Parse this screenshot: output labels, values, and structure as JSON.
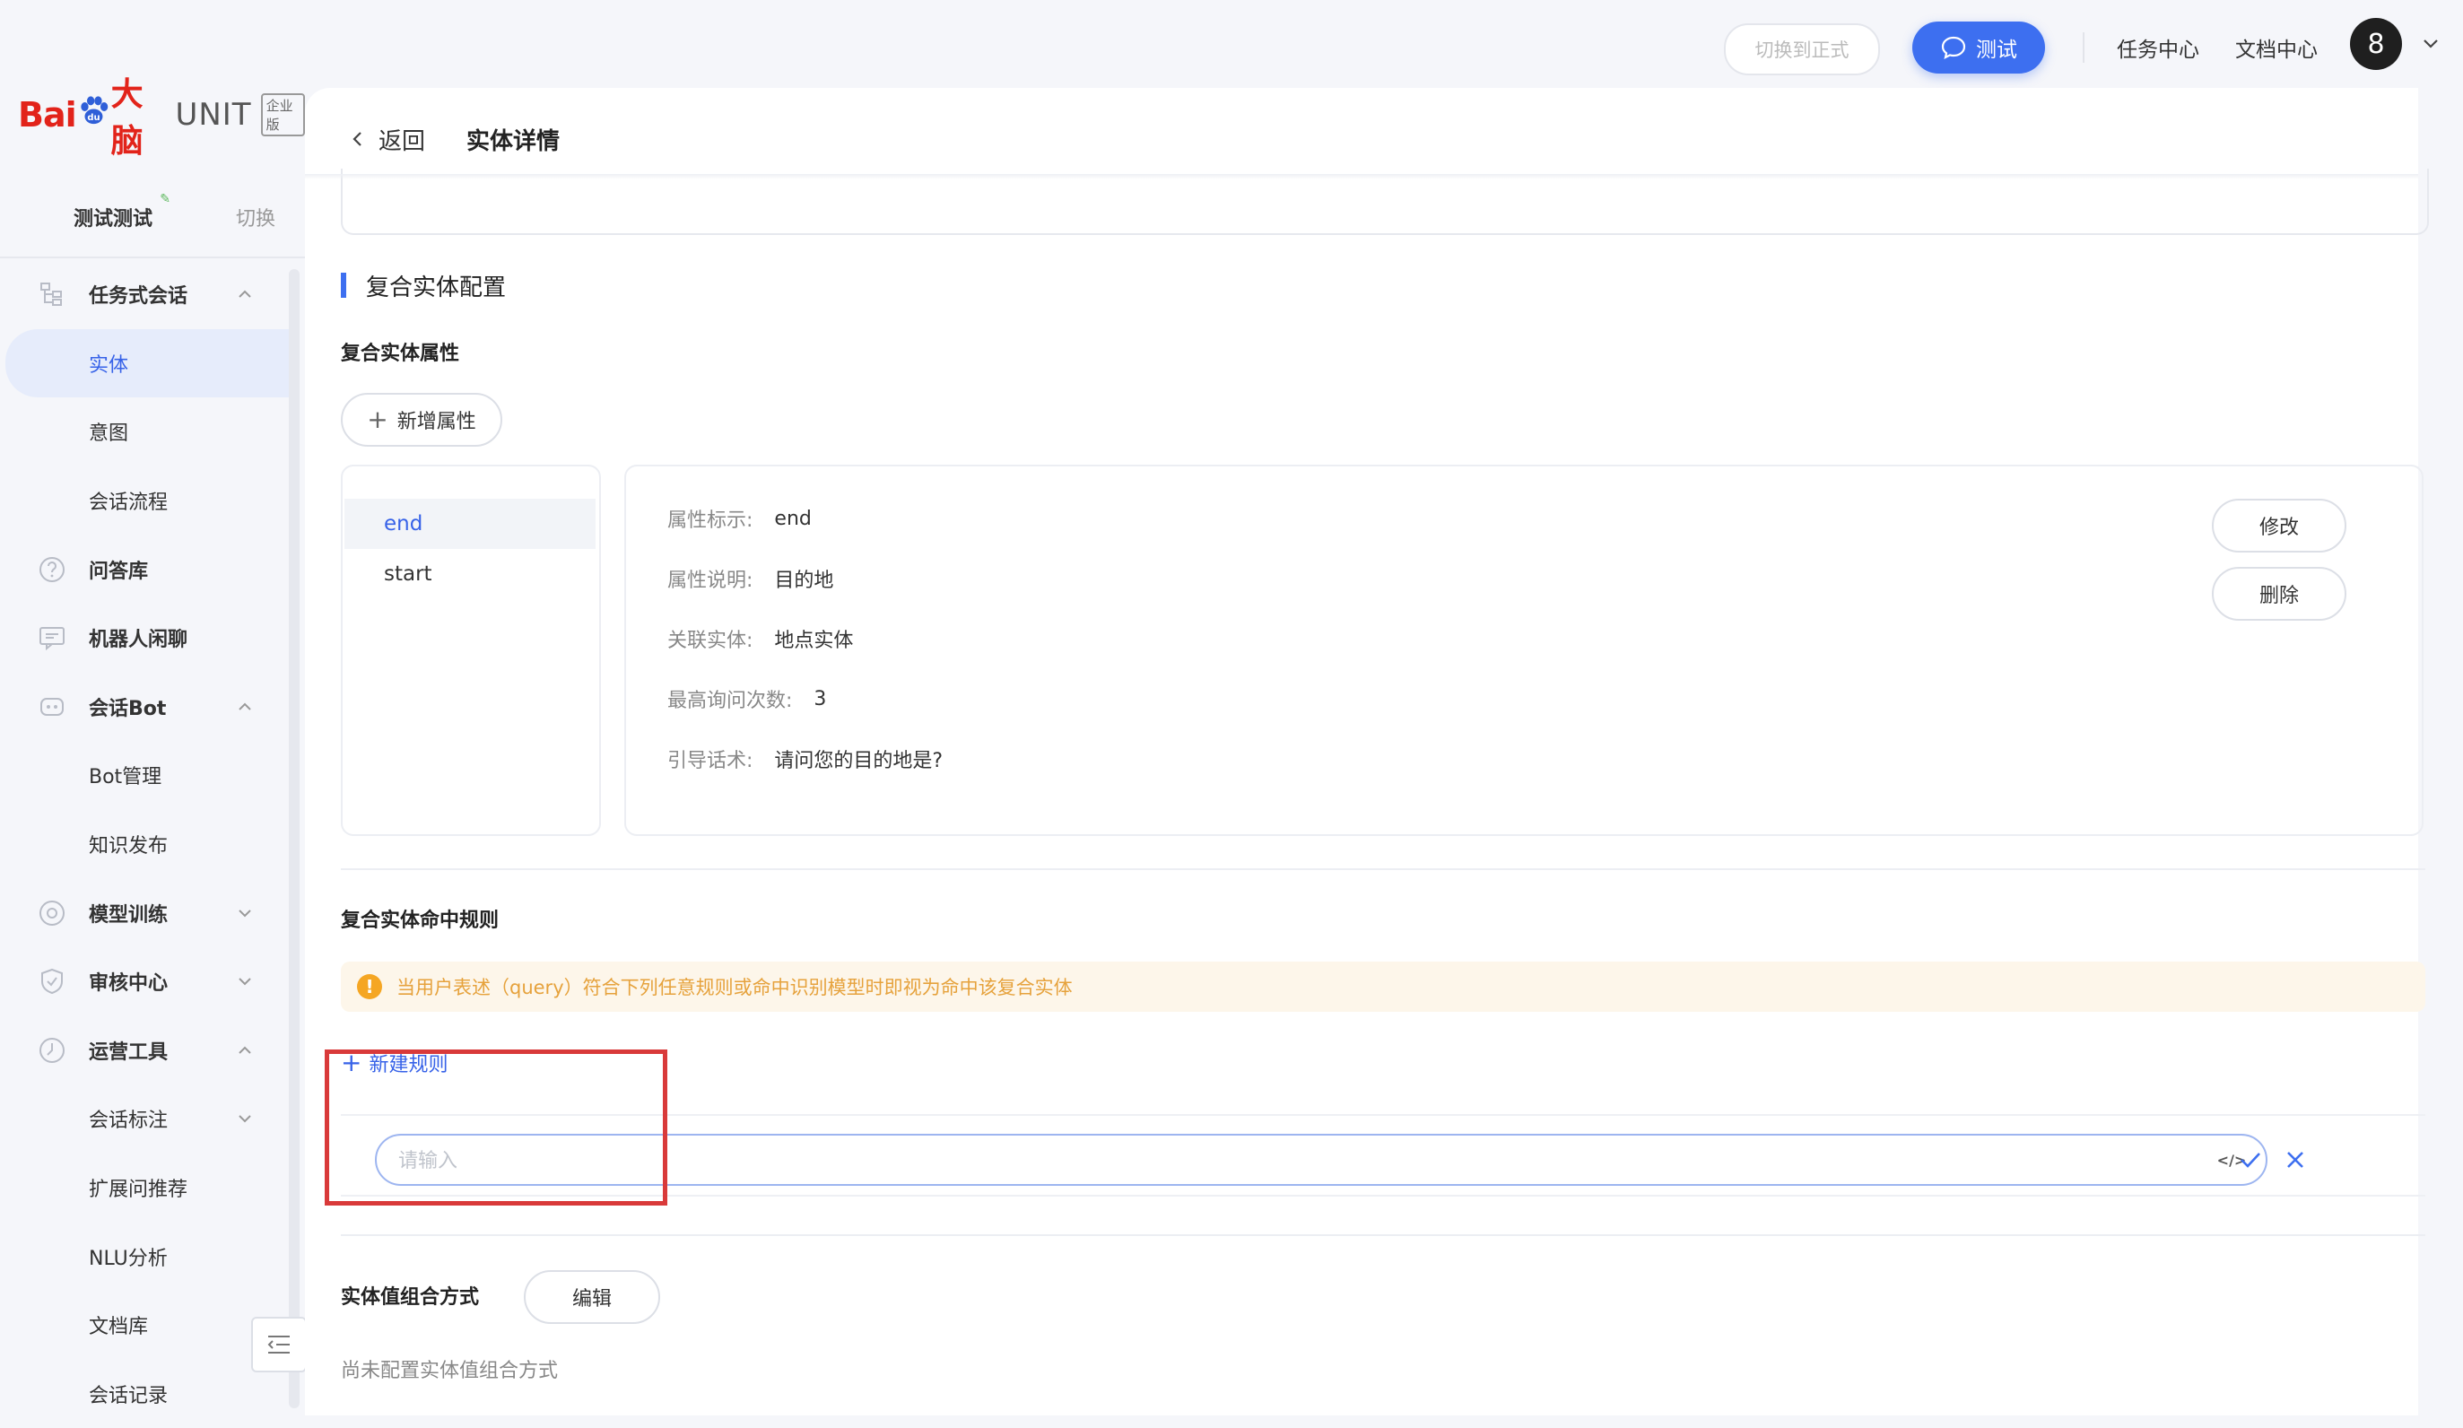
{
  "brand": {
    "logo_bai": "Bai",
    "logo_dan": "大脑",
    "product": "UNIT",
    "edition": "企业版"
  },
  "workspace": {
    "name": "测试测试",
    "switch_label": "切换"
  },
  "sidebar": {
    "items": [
      {
        "label": "任务式会话",
        "icon": "flow-icon",
        "group": true,
        "expanded": true
      },
      {
        "label": "实体",
        "active": true
      },
      {
        "label": "意图"
      },
      {
        "label": "会话流程"
      },
      {
        "label": "问答库",
        "icon": "question-icon",
        "group": true
      },
      {
        "label": "机器人闲聊",
        "icon": "chat-icon",
        "group": true
      },
      {
        "label": "会话Bot",
        "icon": "bot-icon",
        "group": true,
        "expanded": true
      },
      {
        "label": "Bot管理"
      },
      {
        "label": "知识发布"
      },
      {
        "label": "模型训练",
        "icon": "model-icon",
        "group": true,
        "expanded": false
      },
      {
        "label": "审核中心",
        "icon": "shield-icon",
        "group": true,
        "expanded": false
      },
      {
        "label": "运营工具",
        "icon": "tools-icon",
        "group": true,
        "expanded": true
      },
      {
        "label": "会话标注",
        "expanded": false
      },
      {
        "label": "扩展问推荐"
      },
      {
        "label": "NLU分析"
      },
      {
        "label": "文档库"
      },
      {
        "label": "会话记录"
      }
    ]
  },
  "topbar": {
    "switch_label": "切换到正式",
    "test_label": "测试",
    "task_center": "任务中心",
    "doc_center": "文档中心",
    "avatar": "8"
  },
  "header": {
    "back_label": "返回",
    "title": "实体详情"
  },
  "composite": {
    "section_title": "复合实体配置",
    "attr_title": "复合实体属性",
    "add_attr_label": "新增属性",
    "attributes": [
      "end",
      "start"
    ],
    "detail": {
      "fields": [
        {
          "key": "属性标示:",
          "value": "end"
        },
        {
          "key": "属性说明:",
          "value": "目的地"
        },
        {
          "key": "关联实体:",
          "value": "地点实体"
        },
        {
          "key": "最高询问次数:",
          "value": "3"
        },
        {
          "key": "引导话术:",
          "value": "请问您的目的地是?"
        }
      ],
      "edit_label": "修改",
      "delete_label": "删除"
    },
    "rule_title": "复合实体命中规则",
    "notice": "当用户表述（query）符合下列任意规则或命中识别模型时即视为命中该复合实体",
    "new_rule_label": "新建规则",
    "rule_input_placeholder": "请输入",
    "rule_input_value": "",
    "combine_title": "实体值组合方式",
    "combine_edit_label": "编辑",
    "combine_empty": "尚未配置实体值组合方式"
  },
  "colors": {
    "accent": "#3d6ff0",
    "warning": "#f5a623",
    "highlight": "#d93a3a"
  }
}
